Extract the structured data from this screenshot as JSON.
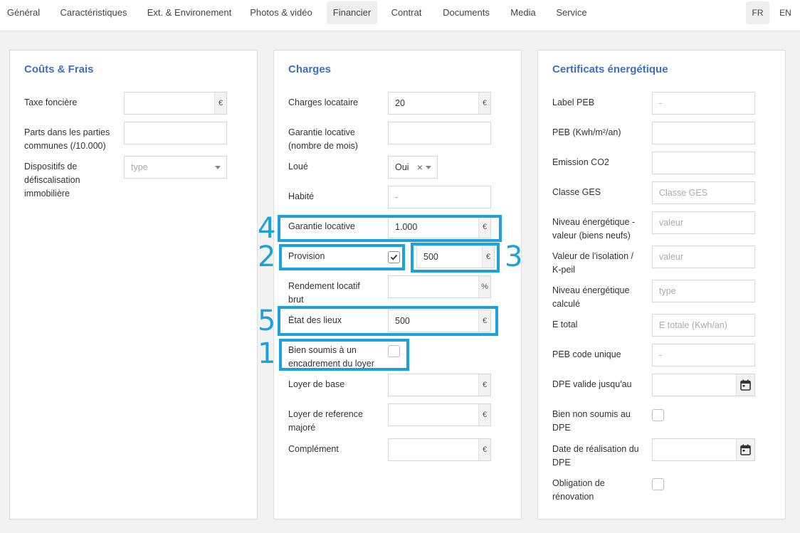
{
  "nav": {
    "tabs": [
      "Général",
      "Caractéristiques",
      "Ext. & Environement",
      "Photos & vidéo",
      "Financier",
      "Contrat",
      "Documents",
      "Media",
      "Service"
    ],
    "active_tab": "Financier",
    "languages": [
      "FR",
      "EN"
    ],
    "active_language": "FR"
  },
  "couts": {
    "title": "Coûts & Frais",
    "taxe_label": "Taxe foncière",
    "taxe_suffix": "€",
    "parts_label_1": "Parts dans les parties",
    "parts_label_2": "communes (/10.000)",
    "defisc_label_1": "Dispositifs de",
    "defisc_label_2": "défiscalisation",
    "defisc_label_3": "immobilière",
    "defisc_placeholder": "type"
  },
  "charges": {
    "title": "Charges",
    "charges_loc_label": "Charges locataire",
    "charges_loc_value": "20",
    "garantie_mois_label_1": "Garantie locative",
    "garantie_mois_label_2": "(nombre de mois)",
    "loue_label": "Loué",
    "loue_value": "Oui",
    "loue_clear": "×",
    "habite_label": "Habité",
    "habite_placeholder": "-",
    "garantie_label": "Garantie locative",
    "garantie_value": "1.000",
    "provision_label": "Provision",
    "provision_checked": true,
    "provision_value": "500",
    "rendement_label_1": "Rendement locatif",
    "rendement_label_2": "brut",
    "rendement_suffix": "%",
    "etat_label": "État des lieux",
    "etat_value": "500",
    "encadrement_label_1": "Bien soumis à un",
    "encadrement_label_2": "encadrement du loyer",
    "encadrement_checked": false,
    "loyer_base_label": "Loyer de base",
    "loyer_ref_label_1": "Loyer de reference",
    "loyer_ref_label_2": "majoré",
    "complement_label": "Complément",
    "currency": "€"
  },
  "certificats": {
    "title": "Certificats énergétique",
    "label_peb_label": "Label PEB",
    "label_peb_placeholder": "-",
    "peb_label": "PEB (Kwh/m²/an)",
    "co2_label": "Emission CO2",
    "ges_label": "Classe GES",
    "ges_placeholder": "Classe GES",
    "niveau_label_1": "Niveau énergétique -",
    "niveau_label_2": "valeur (biens neufs)",
    "niveau_placeholder": "valeur",
    "isolation_label_1": "Valeur de l'isolation /",
    "isolation_label_2": "K-peil",
    "isolation_placeholder": "valeur",
    "calcule_label_1": "Niveau énergétique",
    "calcule_label_2": "calculé",
    "calcule_placeholder": "type",
    "etotal_label": "E total",
    "etotal_placeholder": "E totale (Kwh/an)",
    "peb_code_label": "PEB code unique",
    "peb_code_placeholder": "-",
    "dpe_valide_label": "DPE valide jusqu'au",
    "non_soumis_label_1": "Bien non soumis au",
    "non_soumis_label_2": "DPE",
    "date_real_label_1": "Date de réalisation du",
    "date_real_label_2": "DPE",
    "obligation_label_1": "Obligation de",
    "obligation_label_2": "rénovation"
  },
  "annotations": [
    "1",
    "2",
    "3",
    "4",
    "5"
  ],
  "colors": {
    "accent": "#3b6fc4",
    "annotation": "#1aa1e0"
  }
}
